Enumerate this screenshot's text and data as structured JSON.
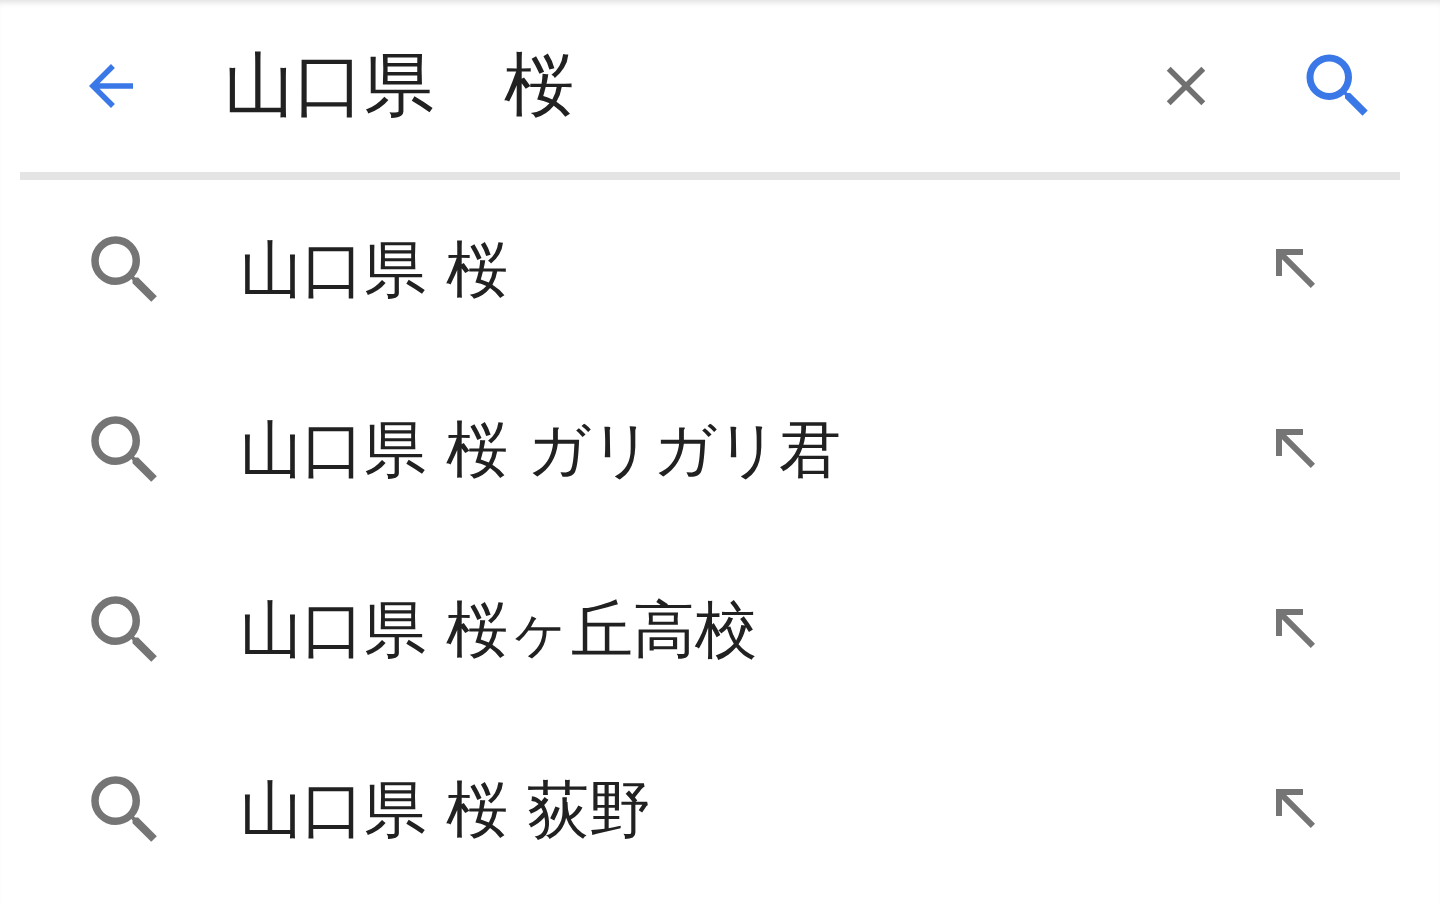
{
  "search": {
    "value": "山口県　桜"
  },
  "suggestions": [
    {
      "text": "山口県 桜"
    },
    {
      "text": "山口県 桜 ガリガリ君"
    },
    {
      "text": "山口県 桜ヶ丘高校"
    },
    {
      "text": "山口県 桜 荻野"
    }
  ]
}
